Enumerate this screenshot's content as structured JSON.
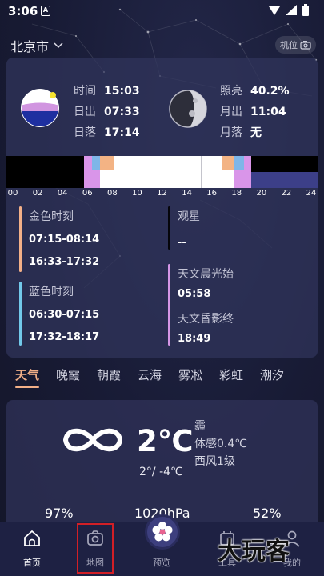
{
  "status_bar": {
    "time": "3:06",
    "notif_letter": "A"
  },
  "header": {
    "city": "北京市",
    "locate_label": "机位"
  },
  "sun": {
    "time_label": "时间",
    "time": "15:03",
    "rise_label": "日出",
    "rise": "07:33",
    "set_label": "日落",
    "set": "17:14"
  },
  "moon": {
    "illum_label": "照亮",
    "illum": "40.2%",
    "rise_label": "月出",
    "rise": "11:04",
    "set_label": "月落",
    "set": "无"
  },
  "timeline_ticks": [
    "00",
    "02",
    "04",
    "06",
    "08",
    "10",
    "12",
    "14",
    "16",
    "18",
    "20",
    "22",
    "24"
  ],
  "golden_hour": {
    "title": "金色时刻",
    "morning": "07:15-08:14",
    "evening": "16:33-17:32"
  },
  "stargazing": {
    "title": "观星",
    "value": "--"
  },
  "blue_hour": {
    "title": "蓝色时刻",
    "morning": "06:30-07:15",
    "evening": "17:32-18:17"
  },
  "astro_dawn": {
    "title": "天文晨光始",
    "value": "05:58"
  },
  "astro_dusk": {
    "title": "天文昏影终",
    "value": "18:49"
  },
  "tabs": [
    "天气",
    "晚霞",
    "朝霞",
    "云海",
    "雾凇",
    "彩虹",
    "潮汐"
  ],
  "weather": {
    "temp": "2℃",
    "range": "2°/ -4℃",
    "condition": "霾",
    "feels": "体感0.4℃",
    "wind": "西风1级",
    "stats": [
      "97%",
      "1020hPa",
      "52%"
    ]
  },
  "nav": {
    "home": "首页",
    "map": "地图",
    "preview": "预览",
    "tool": "工具",
    "mine": "我的"
  },
  "watermark": "大玩客",
  "colors": {
    "accent": "#f3b088",
    "golden": "#f3b088",
    "blue": "#72c9ea",
    "astro": "#d596e6",
    "highlight": "#d21f26"
  }
}
